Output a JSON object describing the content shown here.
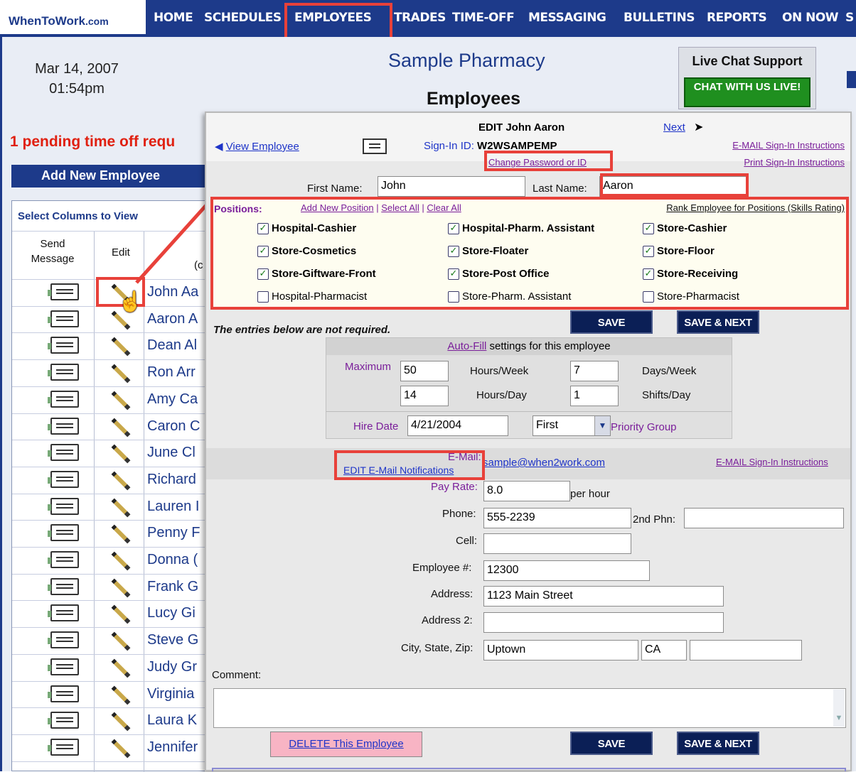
{
  "brand": {
    "name": "WhenToWork",
    "suffix": ".com"
  },
  "nav": [
    "HOME",
    "SCHEDULES",
    "EMPLOYEES",
    "TRADES",
    "TIME-OFF",
    "MESSAGING",
    "BULLETINS",
    "REPORTS",
    "ON NOW",
    "S"
  ],
  "header": {
    "date": "Mar 14, 2007",
    "time": "01:54pm",
    "company": "Sample Pharmacy",
    "title": "Employees",
    "chat_label": "Live Chat Support",
    "chat_button": "CHAT WITH US LIVE!"
  },
  "pending": "1 pending time off requ",
  "add_new": "Add New Employee",
  "table": {
    "select_columns": "Select Columns to View",
    "col_send": "Send Message",
    "col_edit": "Edit",
    "col_partial": "(c",
    "employees": [
      "John Aa",
      "Aaron A",
      "Dean Al",
      "Ron Arr",
      "Amy Ca",
      "Caron C",
      "June Cl",
      "Richard",
      "Lauren I",
      "Penny F",
      "Donna (",
      "Frank G",
      "Lucy Gi",
      "Steve G",
      "Judy Gr",
      "Virginia",
      "Laura K",
      "Jennifer"
    ]
  },
  "modal": {
    "title": "EDIT John Aaron",
    "next": "Next",
    "view_employee": "View Employee",
    "signin_label": "Sign-In ID:",
    "signin_id": "W2WSAMPEMP",
    "change_password": "Change Password or ID",
    "email_signin": "E-MAIL Sign-In Instructions",
    "print_signin": "Print Sign-In Instructions",
    "first_name_label": "First Name:",
    "first_name": "John",
    "last_name_label": "Last Name:",
    "last_name": "Aaron",
    "positions_label": "Positions:",
    "add_position": "Add New Position",
    "select_all": "Select All",
    "clear_all": "Clear All",
    "rank_link": "Rank Employee for Positions (Skills Rating)",
    "positions": [
      {
        "label": "Hospital-Cashier",
        "checked": true
      },
      {
        "label": "Hospital-Pharm. Assistant",
        "checked": true
      },
      {
        "label": "Store-Cashier",
        "checked": true
      },
      {
        "label": "Store-Cosmetics",
        "checked": true
      },
      {
        "label": "Store-Floater",
        "checked": true
      },
      {
        "label": "Store-Floor",
        "checked": true
      },
      {
        "label": "Store-Giftware-Front",
        "checked": true
      },
      {
        "label": "Store-Post Office",
        "checked": true
      },
      {
        "label": "Store-Receiving",
        "checked": true
      },
      {
        "label": "Hospital-Pharmacist",
        "checked": false
      },
      {
        "label": "Store-Pharm. Assistant",
        "checked": false
      },
      {
        "label": "Store-Pharmacist",
        "checked": false
      }
    ],
    "save": "SAVE",
    "save_next": "SAVE & NEXT",
    "not_required": "The entries below are not required.",
    "autofill": {
      "title_link": "Auto-Fill",
      "title_rest": " settings for this employee",
      "maximum": "Maximum",
      "hours_week": "50",
      "hours_week_label": "Hours/Week",
      "days_week": "7",
      "days_week_label": "Days/Week",
      "hours_day": "14",
      "hours_day_label": "Hours/Day",
      "shifts_day": "1",
      "shifts_day_label": "Shifts/Day",
      "hire_date_label": "Hire Date",
      "hire_date": "4/21/2004",
      "priority": "First",
      "priority_label": "Priority Group"
    },
    "email_label": "E-Mail:",
    "email": "sample@when2work.com",
    "edit_email_notifications": "EDIT E-Mail Notifications",
    "email_signin2": "E-MAIL Sign-In Instructions",
    "pay_rate_label": "Pay Rate:",
    "pay_rate": "8.0",
    "per_hour": "per hour",
    "phone_label": "Phone:",
    "phone": "555-2239",
    "phone2_label": "2nd Phn:",
    "phone2": "",
    "cell_label": "Cell:",
    "cell": "",
    "empnum_label": "Employee #:",
    "empnum": "12300",
    "address_label": "Address:",
    "address": "1123 Main Street",
    "address2_label": "Address 2:",
    "address2": "",
    "city_label": "City, State, Zip:",
    "city": "Uptown",
    "state": "CA",
    "zip": "",
    "comment_label": "Comment:",
    "delete": "DELETE This Employee"
  }
}
